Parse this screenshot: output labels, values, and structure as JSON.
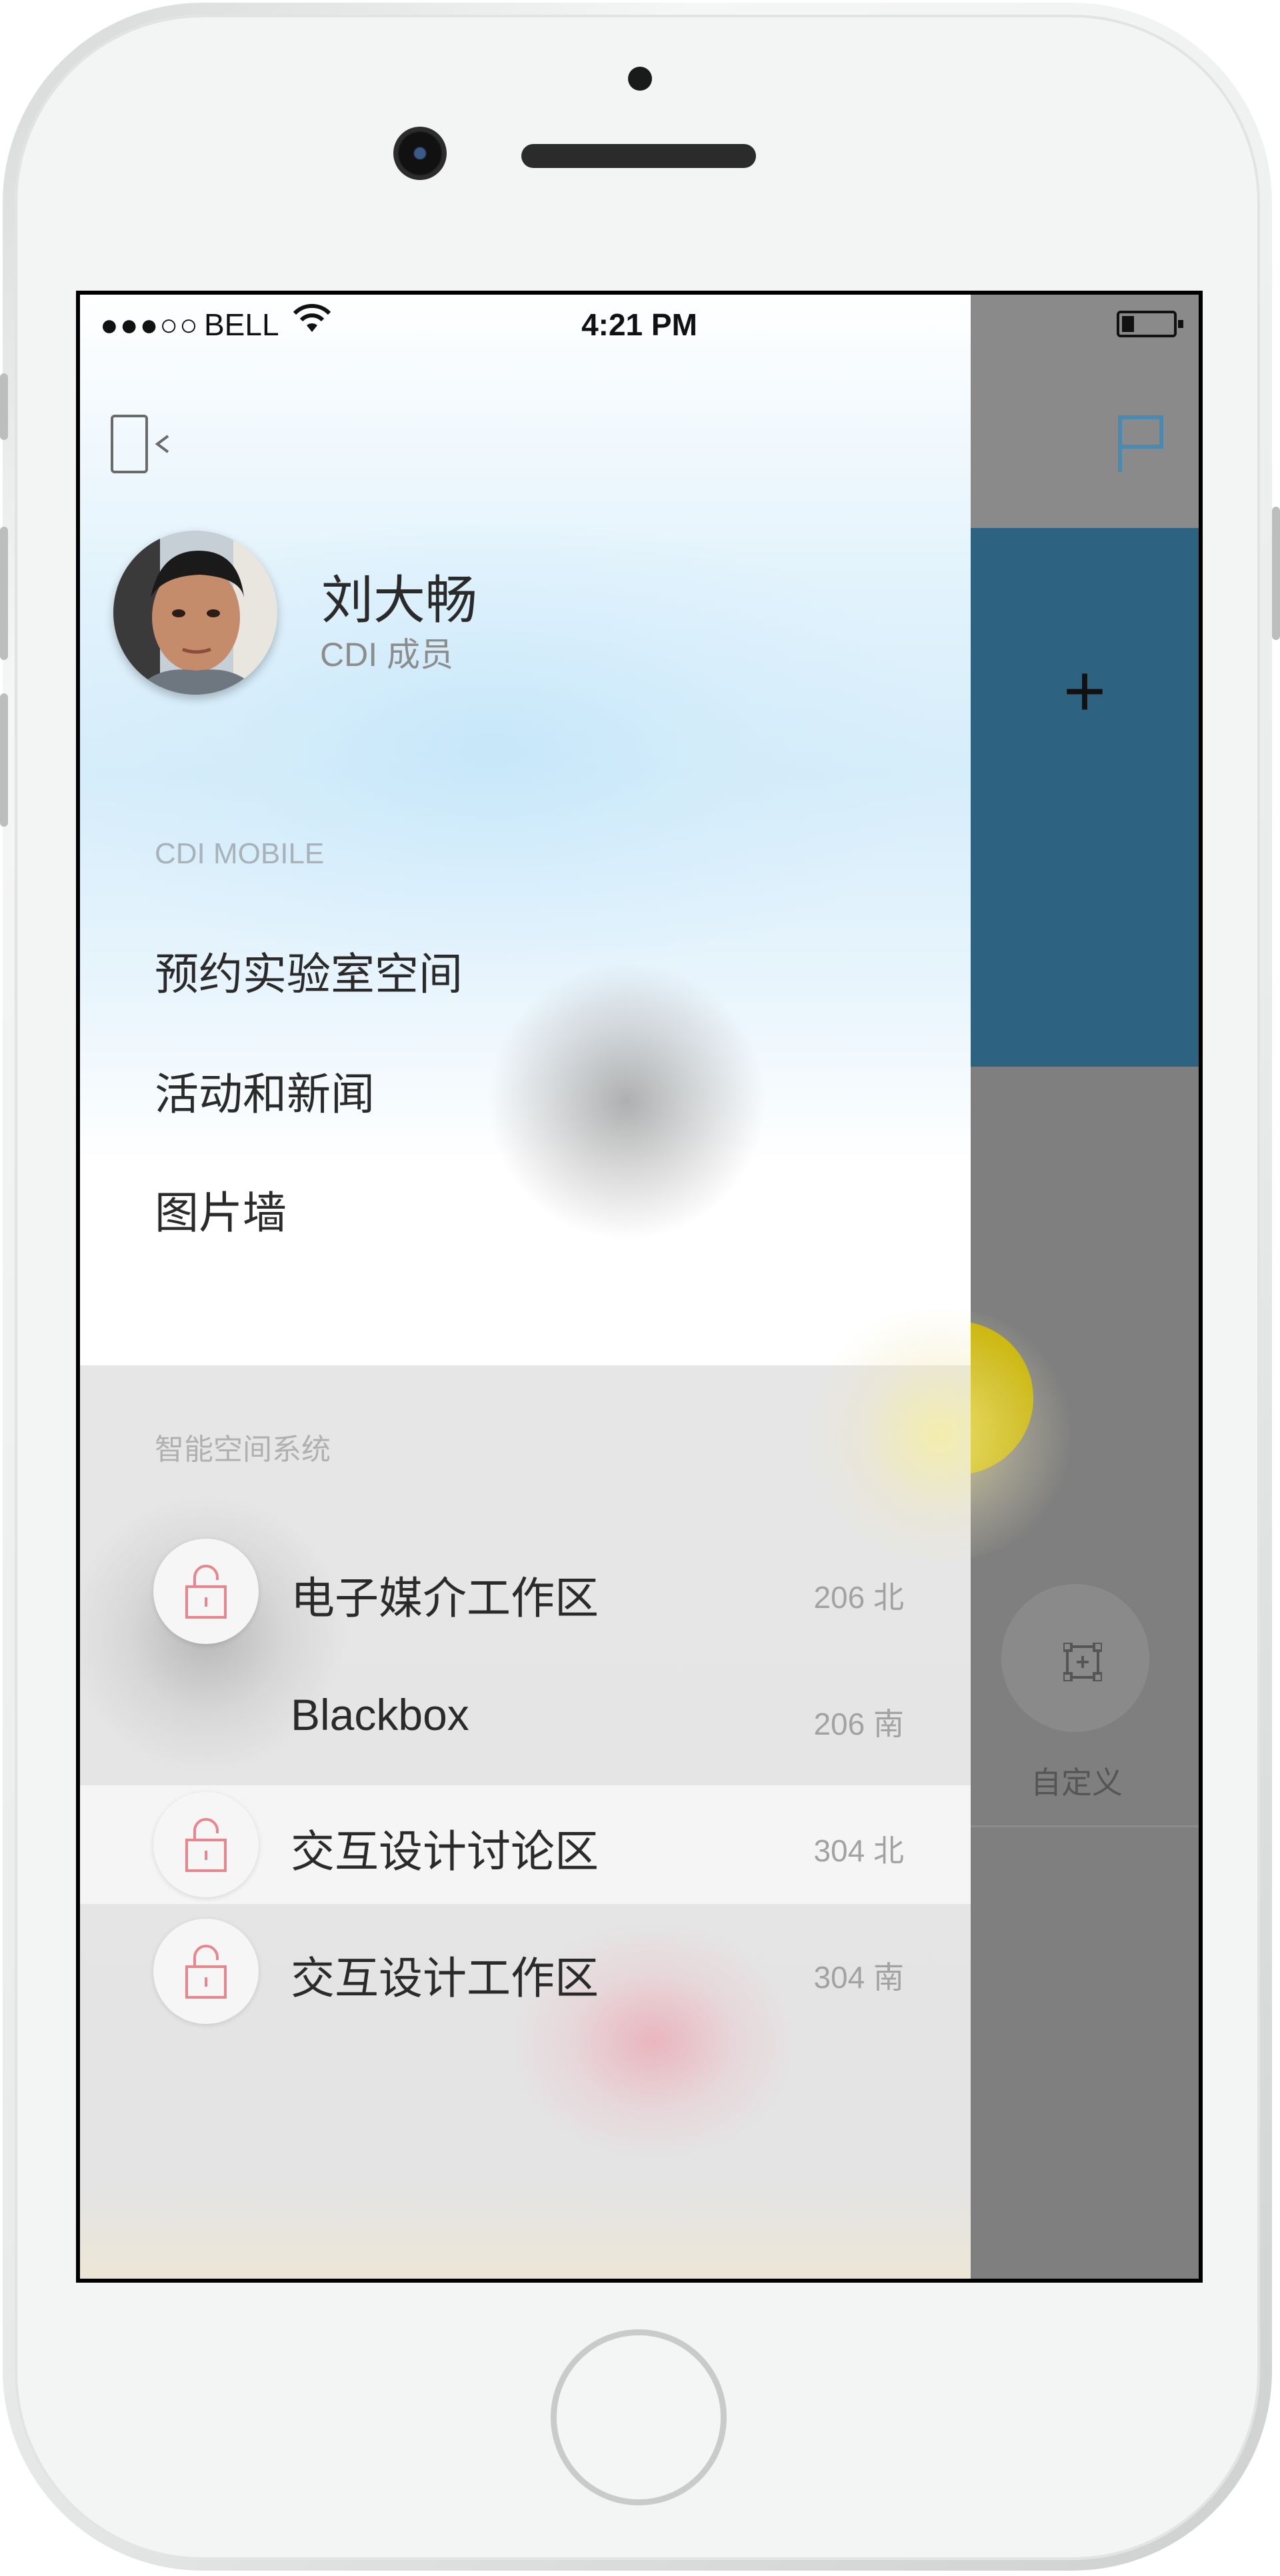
{
  "status_bar": {
    "signal": "●●●○○",
    "carrier": "BELL",
    "time": "4:21 PM"
  },
  "drawer": {
    "user": {
      "name": "刘大畅",
      "role": "CDI 成员"
    },
    "section_label": "CDI MOBILE",
    "menu": [
      {
        "label": "预约实验室空间"
      },
      {
        "label": "活动和新闻"
      },
      {
        "label": "图片墙"
      }
    ],
    "smart_section_label": "智能空间系统",
    "rooms": [
      {
        "name": "电子媒介工作区",
        "location": "206 北",
        "lock_icon": "unlock-icon"
      },
      {
        "name": "Blackbox",
        "location": "206 南",
        "lock_icon": ""
      },
      {
        "name": "交互设计讨论区",
        "location": "304 北",
        "lock_icon": "unlock-icon"
      },
      {
        "name": "交互设计工作区",
        "location": "304 南",
        "lock_icon": "unlock-icon"
      }
    ]
  },
  "background_app": {
    "custom_label": "自定义",
    "accent_color": "#2d6280",
    "flag_color": "#4a8ab0"
  }
}
